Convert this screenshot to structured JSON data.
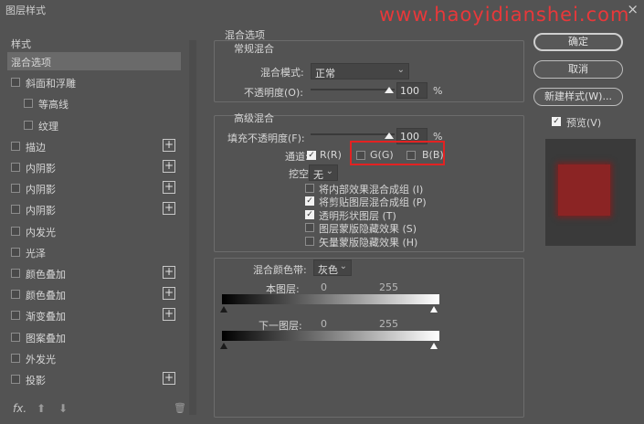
{
  "window": {
    "title": "图层样式",
    "close_icon": "×"
  },
  "watermark": "www.haoyidianshei.com",
  "left_panel": {
    "heading": "样式",
    "items": [
      {
        "label": "混合选项",
        "checkbox": false,
        "plus": false,
        "selected": true
      },
      {
        "label": "斜面和浮雕",
        "checkbox": true,
        "plus": false
      },
      {
        "label": "等高线",
        "checkbox": true,
        "plus": false
      },
      {
        "label": "纹理",
        "checkbox": true,
        "plus": false
      },
      {
        "label": "描边",
        "checkbox": true,
        "plus": true
      },
      {
        "label": "内阴影",
        "checkbox": true,
        "plus": true
      },
      {
        "label": "内阴影",
        "checkbox": true,
        "plus": true
      },
      {
        "label": "内阴影",
        "checkbox": true,
        "plus": true
      },
      {
        "label": "内发光",
        "checkbox": true,
        "plus": false
      },
      {
        "label": "光泽",
        "checkbox": true,
        "plus": false
      },
      {
        "label": "颜色叠加",
        "checkbox": true,
        "plus": true
      },
      {
        "label": "颜色叠加",
        "checkbox": true,
        "plus": true
      },
      {
        "label": "渐变叠加",
        "checkbox": true,
        "plus": true
      },
      {
        "label": "图案叠加",
        "checkbox": true,
        "plus": false
      },
      {
        "label": "外发光",
        "checkbox": true,
        "plus": false
      },
      {
        "label": "投影",
        "checkbox": true,
        "plus": true
      }
    ],
    "plus_glyph": "+",
    "footer": {
      "fx": "fx.",
      "up": "⬆",
      "down": "⬇",
      "trash": "🗑"
    }
  },
  "blend_options": {
    "section_title": "混合选项",
    "general": {
      "title": "常规混合",
      "mode_label": "混合模式:",
      "mode_value": "正常",
      "opacity_label": "不透明度(O):",
      "opacity_value": "100",
      "opacity_unit": "%"
    },
    "advanced": {
      "title": "高级混合",
      "fill_label": "填充不透明度(F):",
      "fill_value": "100",
      "fill_unit": "%",
      "channels_label": "通道:",
      "channels": [
        {
          "label": "R(R)",
          "checked": true
        },
        {
          "label": "G(G)",
          "checked": false
        },
        {
          "label": "B(B)",
          "checked": false
        }
      ],
      "knockout_label": "挖空:",
      "knockout_value": "无",
      "options": [
        {
          "label": "将内部效果混合成组 (I)",
          "checked": false
        },
        {
          "label": "将剪贴图层混合成组 (P)",
          "checked": true
        },
        {
          "label": "透明形状图层 (T)",
          "checked": true
        },
        {
          "label": "图层蒙版隐藏效果 (S)",
          "checked": false
        },
        {
          "label": "矢量蒙版隐藏效果 (H)",
          "checked": false
        }
      ]
    },
    "blend_if": {
      "label": "混合颜色带:",
      "value": "灰色",
      "this_layer": {
        "label": "本图层:",
        "min": "0",
        "max": "255"
      },
      "underlying": {
        "label": "下一图层:",
        "min": "0",
        "max": "255"
      }
    }
  },
  "buttons": {
    "ok": "确定",
    "cancel": "取消",
    "new_style": "新建样式(W)...",
    "preview_label": "预览(V)",
    "preview_checked": true
  },
  "colors": {
    "highlight": "#e32222",
    "preview_swatch": "#8b2424"
  }
}
